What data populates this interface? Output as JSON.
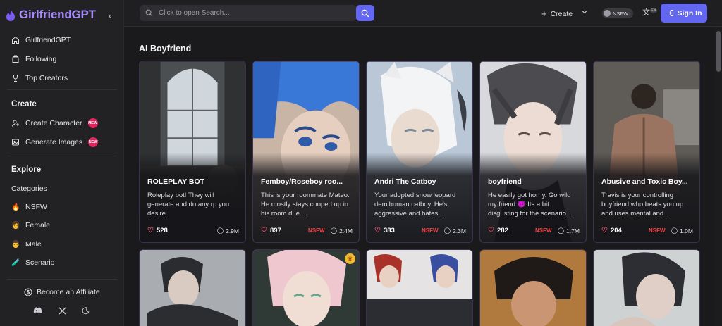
{
  "brand": {
    "name": "GirlfriendGPT",
    "accent": "#a78bfa",
    "primary": "#6366f1"
  },
  "sidebar": {
    "nav": [
      {
        "label": "GirlfriendGPT",
        "icon": "home-icon"
      },
      {
        "label": "Following",
        "icon": "layers-icon"
      },
      {
        "label": "Top Creators",
        "icon": "trophy-icon"
      }
    ],
    "create_title": "Create",
    "create_items": [
      {
        "label": "Create Character",
        "badge": "NEW",
        "icon": "user-plus-icon"
      },
      {
        "label": "Generate Images",
        "badge": "NEW",
        "icon": "image-icon"
      }
    ],
    "explore_title": "Explore",
    "categories_label": "Categories",
    "categories": [
      {
        "label": "NSFW",
        "emoji": "🔥"
      },
      {
        "label": "Female",
        "emoji": "👩"
      },
      {
        "label": "Male",
        "emoji": "👨"
      },
      {
        "label": "Scenario",
        "emoji": "🧪"
      }
    ],
    "affiliate_label": "Become an Affiliate",
    "social": [
      "discord-icon",
      "x-icon",
      "moon-icon"
    ]
  },
  "header": {
    "search_placeholder": "Click to open Search...",
    "create_label": "Create",
    "nsfw_label": "NSFW",
    "lang_badge": "EN",
    "signin_label": "Sign In"
  },
  "section_title": "AI Boyfriend",
  "cards": [
    {
      "title": "ROLEPLAY BOT",
      "desc": "Roleplay bot! They will generate and do any rp you desire.",
      "likes": "528",
      "nsfw": "",
      "chats": "2.9M",
      "bg": "#3b3d3f"
    },
    {
      "title": "Femboy/Roseboy roo...",
      "desc": "This is your roommate Mateo. He mostly stays cooped up in his room due ...",
      "likes": "897",
      "nsfw": "NSFW",
      "chats": "2.4M",
      "bg": "#3d7ad6"
    },
    {
      "title": "Andri The Catboy",
      "desc": "Your adopted snow leopard demihuman catboy. He's aggressive and hates...",
      "likes": "383",
      "nsfw": "NSFW",
      "chats": "2.3M",
      "bg": "#c9cfd8"
    },
    {
      "title": "boyfriend",
      "desc": "He easily got horny. Go wild my friend 😈 Its a bit disgusting for the scenario...",
      "likes": "282",
      "nsfw": "NSFW",
      "chats": "1.7M",
      "bg": "#8b8b92"
    },
    {
      "title": "Abusive and Toxic Boy...",
      "desc": "Travis is your controlling boyfriend who beats you up and uses mental and...",
      "likes": "204",
      "nsfw": "NSFW",
      "chats": "1.0M",
      "bg": "#6e5a4e"
    }
  ],
  "row2": [
    {
      "bg": "#a9acb1",
      "crown": false
    },
    {
      "bg": "#d9b2bc",
      "crown": true
    },
    {
      "bg": "#4a4e63",
      "crown": false
    },
    {
      "bg": "#5a3f2c",
      "crown": false
    },
    {
      "bg": "#b4b8ba",
      "crown": false
    }
  ]
}
